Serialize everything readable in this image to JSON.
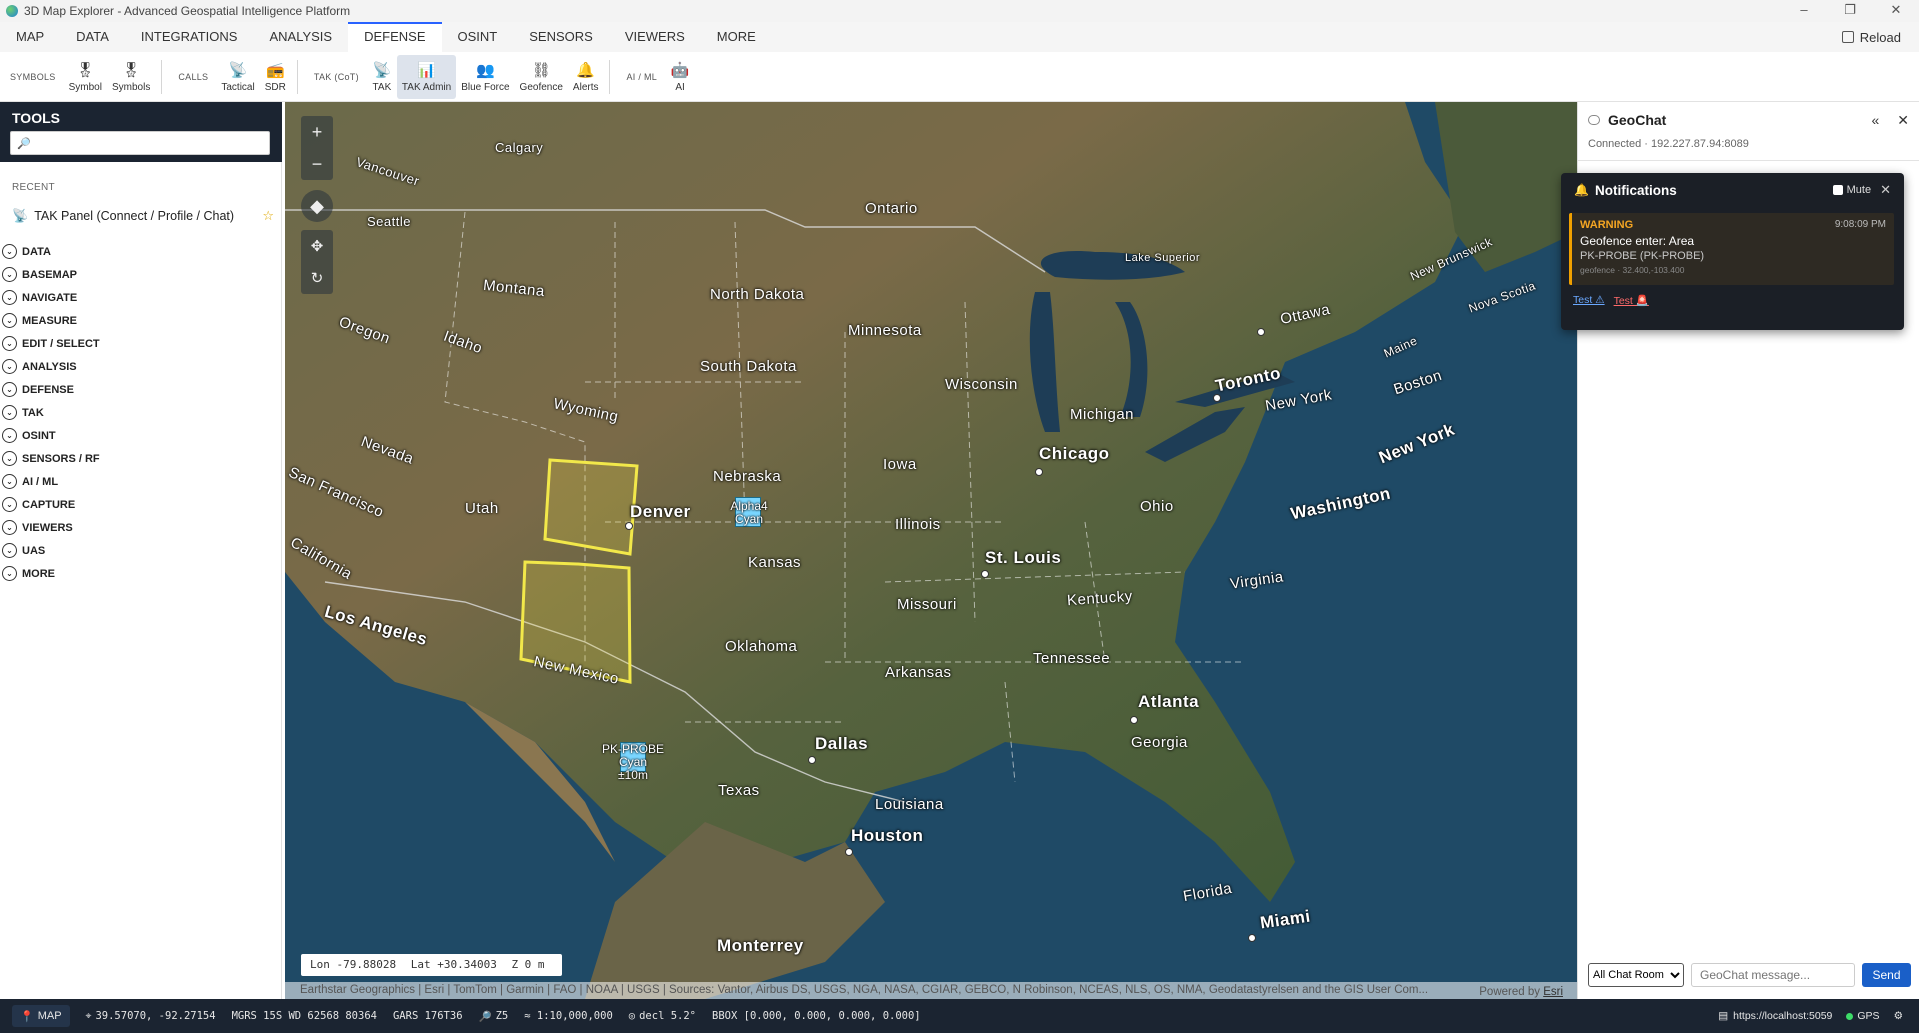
{
  "window": {
    "title": "3D Map Explorer - Advanced Geospatial Intelligence Platform"
  },
  "menu": {
    "items": [
      "MAP",
      "DATA",
      "INTEGRATIONS",
      "ANALYSIS",
      "DEFENSE",
      "OSINT",
      "SENSORS",
      "VIEWERS",
      "MORE"
    ],
    "active": "DEFENSE",
    "reload_label": "Reload"
  },
  "toolbar": {
    "symbols_group": "SYMBOLS",
    "symbol_label": "Symbol",
    "symbols_label": "Symbols",
    "calls_group": "CALLS",
    "tactical_label": "Tactical",
    "sdr_label": "SDR",
    "tak_group": "TAK (CoT)",
    "tak_label": "TAK",
    "tak_admin_label": "TAK Admin",
    "blue_force_label": "Blue Force",
    "geofence_label": "Geofence",
    "alerts_label": "Alerts",
    "aiml_group": "AI / ML",
    "ai_label": "AI"
  },
  "tools": {
    "title": "TOOLS",
    "search_placeholder": "",
    "recent_label": "RECENT",
    "recent_item": "TAK Panel (Connect / Profile / Chat)",
    "sections": [
      "DATA",
      "BASEMAP",
      "NAVIGATE",
      "MEASURE",
      "EDIT / SELECT",
      "ANALYSIS",
      "DEFENSE",
      "TAK",
      "OSINT",
      "SENSORS / RF",
      "AI / ML",
      "CAPTURE",
      "VIEWERS",
      "UAS",
      "MORE"
    ]
  },
  "map": {
    "labels": {
      "calgary": "Calgary",
      "vancouver": "Vancouver",
      "seattle": "Seattle",
      "ontario": "Ontario",
      "montana": "Montana",
      "north_dakota": "North Dakota",
      "minnesota": "Minnesota",
      "oregon": "Oregon",
      "idaho": "Idaho",
      "south_dakota": "South Dakota",
      "wisconsin": "Wisconsin",
      "michigan": "Michigan",
      "wyoming": "Wyoming",
      "nebraska": "Nebraska",
      "iowa": "Iowa",
      "nevada": "Nevada",
      "utah": "Utah",
      "san_francisco": "San Francisco",
      "california": "California",
      "denver": "Denver",
      "kansas": "Kansas",
      "illinois": "Illinois",
      "ohio": "Ohio",
      "missouri": "Missouri",
      "kentucky": "Kentucky",
      "los_angeles": "Los Angeles",
      "oklahoma": "Oklahoma",
      "new_mexico": "New Mexico",
      "arkansas": "Arkansas",
      "tennessee": "Tennessee",
      "virginia": "Virginia",
      "texas": "Texas",
      "dallas": "Dallas",
      "louisiana": "Louisiana",
      "houston": "Houston",
      "atlanta": "Atlanta",
      "georgia": "Georgia",
      "florida": "Florida",
      "miami": "Miami",
      "monterrey": "Monterrey",
      "chicago": "Chicago",
      "st_louis": "St. Louis",
      "toronto": "Toronto",
      "ottawa": "Ottawa",
      "new_york_state": "New York",
      "new_york": "New York",
      "boston": "Boston",
      "washington": "Washington",
      "maine": "Maine",
      "new_brunswick": "New Brunswick",
      "nova_scotia": "Nova Scotia",
      "lake_superior": "Lake Superior"
    },
    "units": {
      "alpha_name": "Alpha4",
      "alpha_color": "Cyan",
      "probe_name": "PK-PROBE",
      "probe_color": "Cyan",
      "probe_acc": "±10m"
    },
    "coords": {
      "lon": "Lon -79.88028",
      "lat": "Lat +30.34003",
      "z": "Z 0 m"
    },
    "attribution": "Earthstar Geographics | Esri | TomTom | Garmin | FAO | NOAA | USGS | Sources: Vantor, Airbus DS, USGS, NGA, NASA, CGIAR, GEBCO, N Robinson, NCEAS, NLS, OS, NMA, Geodatastyrelsen and the GIS User Com...",
    "powered_prefix": "Powered by ",
    "powered_brand": "Esri"
  },
  "geochat": {
    "title": "GeoChat",
    "connection": "Connected · 192.227.87.94:8089",
    "room": "All Chat Room",
    "message_placeholder": "GeoChat message...",
    "send_label": "Send"
  },
  "notifications": {
    "title": "Notifications",
    "mute_label": "Mute",
    "level": "WARNING",
    "time": "9:08:09 PM",
    "headline": "Geofence enter: Area",
    "subject": "PK-PROBE (PK-PROBE)",
    "meta": "geofence · 32.400,-103.400",
    "test_warn": "Test ⚠",
    "test_err": "Test 🚨"
  },
  "status": {
    "mode": "MAP",
    "latlon": "39.57070, -92.27154",
    "mgrs": "MGRS 15S WD 62568 80364",
    "gars": "GARS 176T36",
    "zoom": "Z5",
    "scale": "≈ 1:10,000,000",
    "decl": "decl 5.2°",
    "bbox": "BBOX [0.000, 0.000, 0.000, 0.000]",
    "server": "https://localhost:5059",
    "gps": "GPS"
  },
  "colors": {
    "accent": "#2962ff",
    "panel_dark": "#1b2431",
    "send": "#1a5fc8",
    "warning": "#f5a623",
    "geofence": "#f0e040"
  }
}
